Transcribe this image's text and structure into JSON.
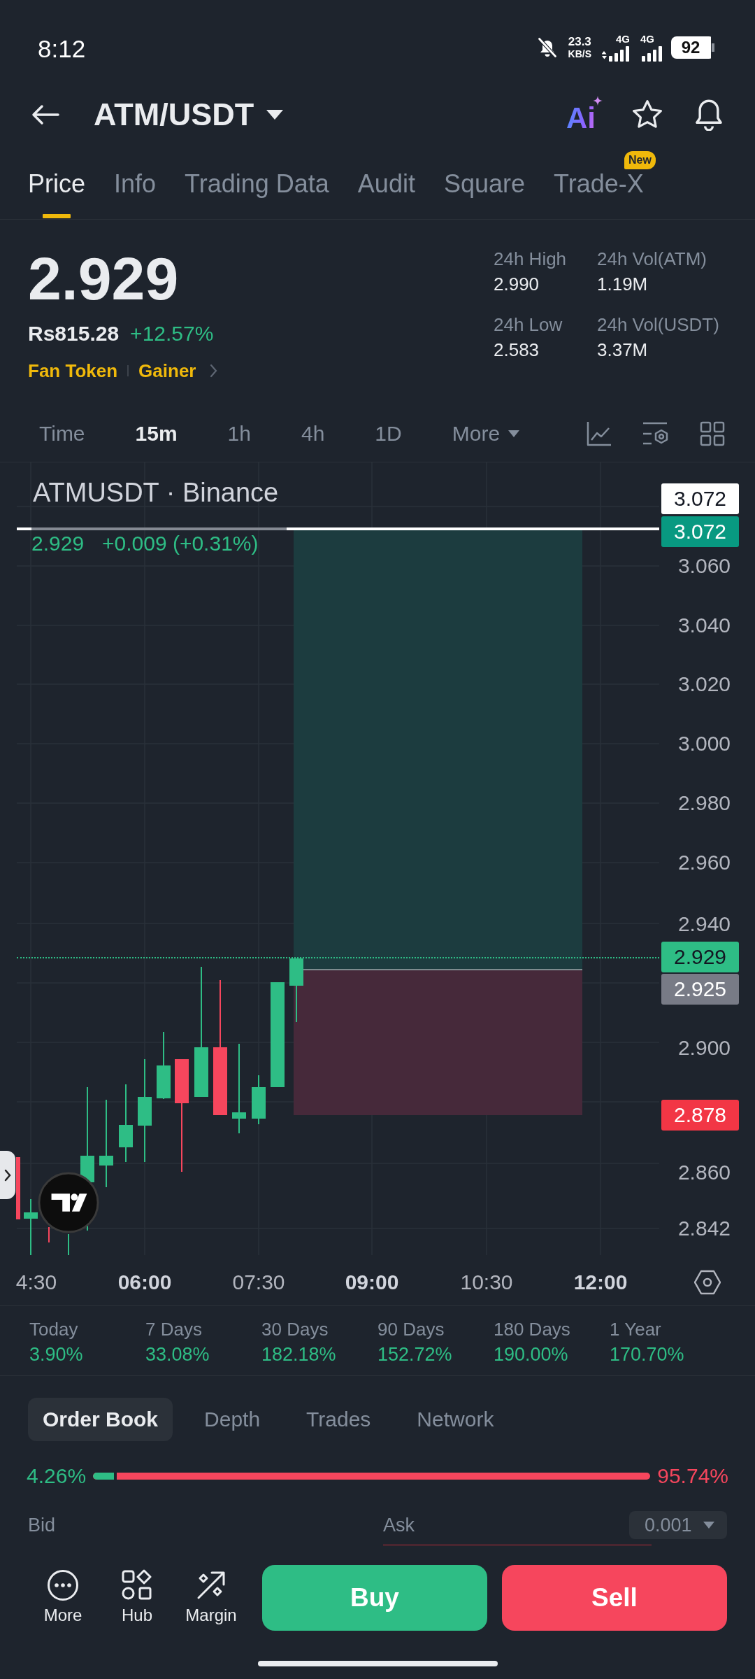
{
  "status_bar": {
    "time": "8:12",
    "net_speed": "23.3",
    "net_speed_unit": "KB/S",
    "networks": [
      "4G",
      "4G"
    ],
    "battery": "92"
  },
  "header": {
    "title": "ATM/USDT",
    "ai_label": "Ai"
  },
  "tabs": [
    {
      "label": "Price",
      "selected": true
    },
    {
      "label": "Info",
      "selected": false
    },
    {
      "label": "Trading Data",
      "selected": false
    },
    {
      "label": "Audit",
      "selected": false
    },
    {
      "label": "Square",
      "selected": false
    },
    {
      "label": "Trade-X",
      "selected": false,
      "badge": "New"
    }
  ],
  "ticker": {
    "price": "2.929",
    "fiat_price": "Rs815.28",
    "change": "+12.57%",
    "tags": [
      "Fan Token",
      "Gainer"
    ],
    "stats": [
      {
        "label": "24h High",
        "value": "2.990"
      },
      {
        "label": "24h Vol(ATM)",
        "value": "1.19M"
      },
      {
        "label": "24h Low",
        "value": "2.583"
      },
      {
        "label": "24h Vol(USDT)",
        "value": "3.37M"
      }
    ]
  },
  "intervals": [
    {
      "label": "Time",
      "selected": false,
      "kind": "option"
    },
    {
      "label": "15m",
      "selected": true,
      "kind": "option"
    },
    {
      "label": "1h",
      "selected": false,
      "kind": "option"
    },
    {
      "label": "4h",
      "selected": false,
      "kind": "option"
    },
    {
      "label": "1D",
      "selected": false,
      "kind": "option"
    },
    {
      "label": "More",
      "selected": false,
      "kind": "menu"
    }
  ],
  "chart": {
    "title": "ATMUSDT · Binance",
    "legend": {
      "price": "2.929",
      "change": "+0.009 (+0.31%)"
    },
    "price_ticks": [
      "3.060",
      "3.040",
      "3.020",
      "3.000",
      "2.980",
      "2.960",
      "2.940",
      "2.900",
      "2.860",
      "2.842"
    ],
    "price_tags": [
      {
        "label": "3.072",
        "color": "#ffffff"
      },
      {
        "label": "3.072",
        "color": "#089981"
      },
      {
        "label": "2.929",
        "color": "#2ebd85"
      },
      {
        "label": "2.925",
        "color": "#787b86"
      },
      {
        "label": "2.878",
        "color": "#f23645"
      }
    ],
    "time_ticks": [
      {
        "label": "4:30",
        "major": false
      },
      {
        "label": "06:00",
        "major": true
      },
      {
        "label": "07:30",
        "major": false
      },
      {
        "label": "09:00",
        "major": true
      },
      {
        "label": "10:30",
        "major": false
      },
      {
        "label": "12:00",
        "major": true
      }
    ]
  },
  "performance": [
    {
      "label": "Today",
      "value": "3.90%"
    },
    {
      "label": "7 Days",
      "value": "33.08%"
    },
    {
      "label": "30 Days",
      "value": "182.18%"
    },
    {
      "label": "90 Days",
      "value": "152.72%"
    },
    {
      "label": "180 Days",
      "value": "190.00%"
    },
    {
      "label": "1 Year",
      "value": "170.70%"
    }
  ],
  "book": {
    "tabs": [
      {
        "label": "Order Book",
        "selected": true
      },
      {
        "label": "Depth",
        "selected": false
      },
      {
        "label": "Trades",
        "selected": false
      },
      {
        "label": "Network",
        "selected": false
      }
    ],
    "ratio": {
      "bid": "4.26%",
      "ask": "95.74%",
      "level": 0.0426
    },
    "bid_label": "Bid",
    "ask_label": "Ask",
    "precision": "0.001"
  },
  "bottom_bar": {
    "actions": [
      {
        "label": "More"
      },
      {
        "label": "Hub"
      },
      {
        "label": "Margin"
      }
    ],
    "buy": "Buy",
    "sell": "Sell"
  }
}
